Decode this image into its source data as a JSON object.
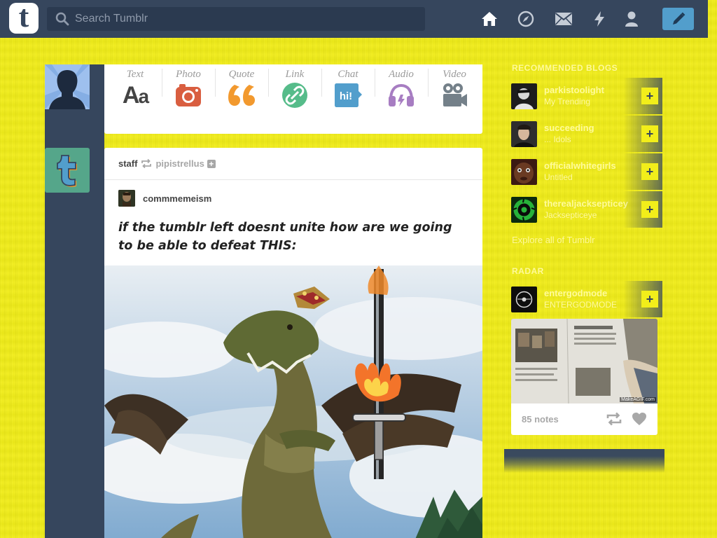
{
  "search": {
    "placeholder": "Search Tumblr"
  },
  "logo": {
    "letter": "t"
  },
  "post_types": [
    {
      "label": "Text",
      "icon": "text-icon",
      "color": "#444444"
    },
    {
      "label": "Photo",
      "icon": "camera-icon",
      "color": "#d95e40"
    },
    {
      "label": "Quote",
      "icon": "quote-icon",
      "color": "#f2992e"
    },
    {
      "label": "Link",
      "icon": "link-icon",
      "color": "#56bc8a"
    },
    {
      "label": "Chat",
      "icon": "chat-icon",
      "color": "#529ecc"
    },
    {
      "label": "Audio",
      "icon": "headphones-icon",
      "color": "#a77dc2"
    },
    {
      "label": "Video",
      "icon": "video-camera-icon",
      "color": "#748089"
    }
  ],
  "post": {
    "reblogger": "staff",
    "source": "pipistrellus",
    "author": "commmemeism",
    "title": "if the tumblr left doesnt unite how are we going to be able to defeat THIS:"
  },
  "recommended": {
    "heading": "RECOMMENDED BLOGS",
    "items": [
      {
        "name": "parkistoolight",
        "sub": "My Trending"
      },
      {
        "name": "succeeding",
        "sub": "... Idols"
      },
      {
        "name": "officialwhitegirls",
        "sub": "Untitled"
      },
      {
        "name": "therealjacksepticeye",
        "sub": "Jacksepticeye"
      }
    ],
    "explore": "Explore all of Tumblr"
  },
  "radar": {
    "heading": "RADAR",
    "blog": {
      "name": "entergodmode",
      "sub": "ENTERGODMODE"
    },
    "notes": "85 notes",
    "watermark": "MakeAGIF.com"
  },
  "colors": {
    "navy": "#36465d",
    "background": "#f2ee1a",
    "compose": "#529ecc"
  }
}
